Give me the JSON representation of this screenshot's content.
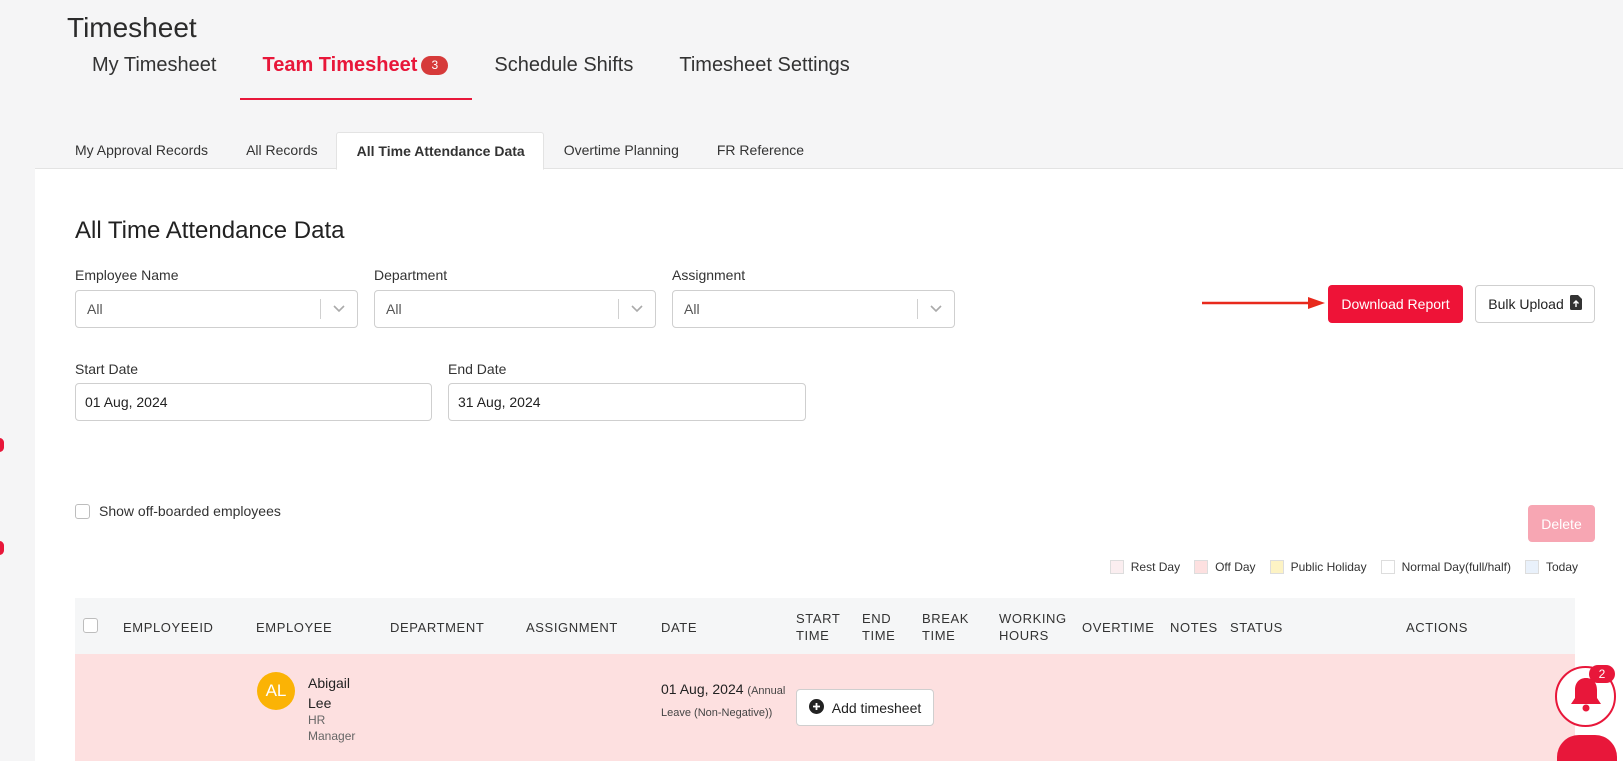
{
  "page": {
    "title": "Timesheet"
  },
  "main_tabs": [
    {
      "label": "My Timesheet"
    },
    {
      "label": "Team Timesheet",
      "badge": "3"
    },
    {
      "label": "Schedule Shifts"
    },
    {
      "label": "Timesheet Settings"
    }
  ],
  "sub_tabs": [
    {
      "label": "My Approval Records"
    },
    {
      "label": "All Records"
    },
    {
      "label": "All Time Attendance Data"
    },
    {
      "label": "Overtime Planning"
    },
    {
      "label": "FR Reference"
    }
  ],
  "section": {
    "title": "All Time Attendance Data"
  },
  "filters": {
    "employee_name": {
      "label": "Employee Name",
      "value": "All"
    },
    "department": {
      "label": "Department",
      "value": "All"
    },
    "assignment": {
      "label": "Assignment",
      "value": "All"
    },
    "start_date": {
      "label": "Start Date",
      "value": "01 Aug, 2024"
    },
    "end_date": {
      "label": "End Date",
      "value": "31 Aug, 2024"
    }
  },
  "actions": {
    "download_report": "Download Report",
    "bulk_upload": "Bulk Upload",
    "delete": "Delete"
  },
  "show_offboarded": {
    "label": "Show off-boarded employees",
    "checked": false
  },
  "legend": [
    {
      "label": "Rest Day",
      "color": "#fbeef0"
    },
    {
      "label": "Off Day",
      "color": "#fde0e0"
    },
    {
      "label": "Public Holiday",
      "color": "#fdf3c4"
    },
    {
      "label": "Normal Day(full/half)",
      "color": "#ffffff"
    },
    {
      "label": "Today",
      "color": "#e9f1fb"
    }
  ],
  "table": {
    "columns": {
      "employeeid": "EMPLOYEEID",
      "employee": "EMPLOYEE",
      "department": "DEPARTMENT",
      "assignment": "ASSIGNMENT",
      "date": "DATE",
      "start_time": "START TIME",
      "end_time": "END TIME",
      "break_time": "BREAK TIME",
      "working_hours": "WORKING HOURS",
      "overtime": "OVERTIME",
      "notes": "NOTES",
      "status": "STATUS",
      "actions": "ACTIONS"
    },
    "rows": [
      {
        "initials": "AL",
        "name": "Abigail Lee",
        "role": "HR Manager",
        "date": "01 Aug, 2024",
        "date_note": "(Annual Leave (Non-Negative))",
        "action": "Add timesheet"
      }
    ]
  },
  "notifications": {
    "count": "2"
  },
  "colors": {
    "accent": "#e8173a",
    "primary_button": "#ee1337",
    "off_day_row": "#fde0e0",
    "avatar": "#fbb305"
  }
}
